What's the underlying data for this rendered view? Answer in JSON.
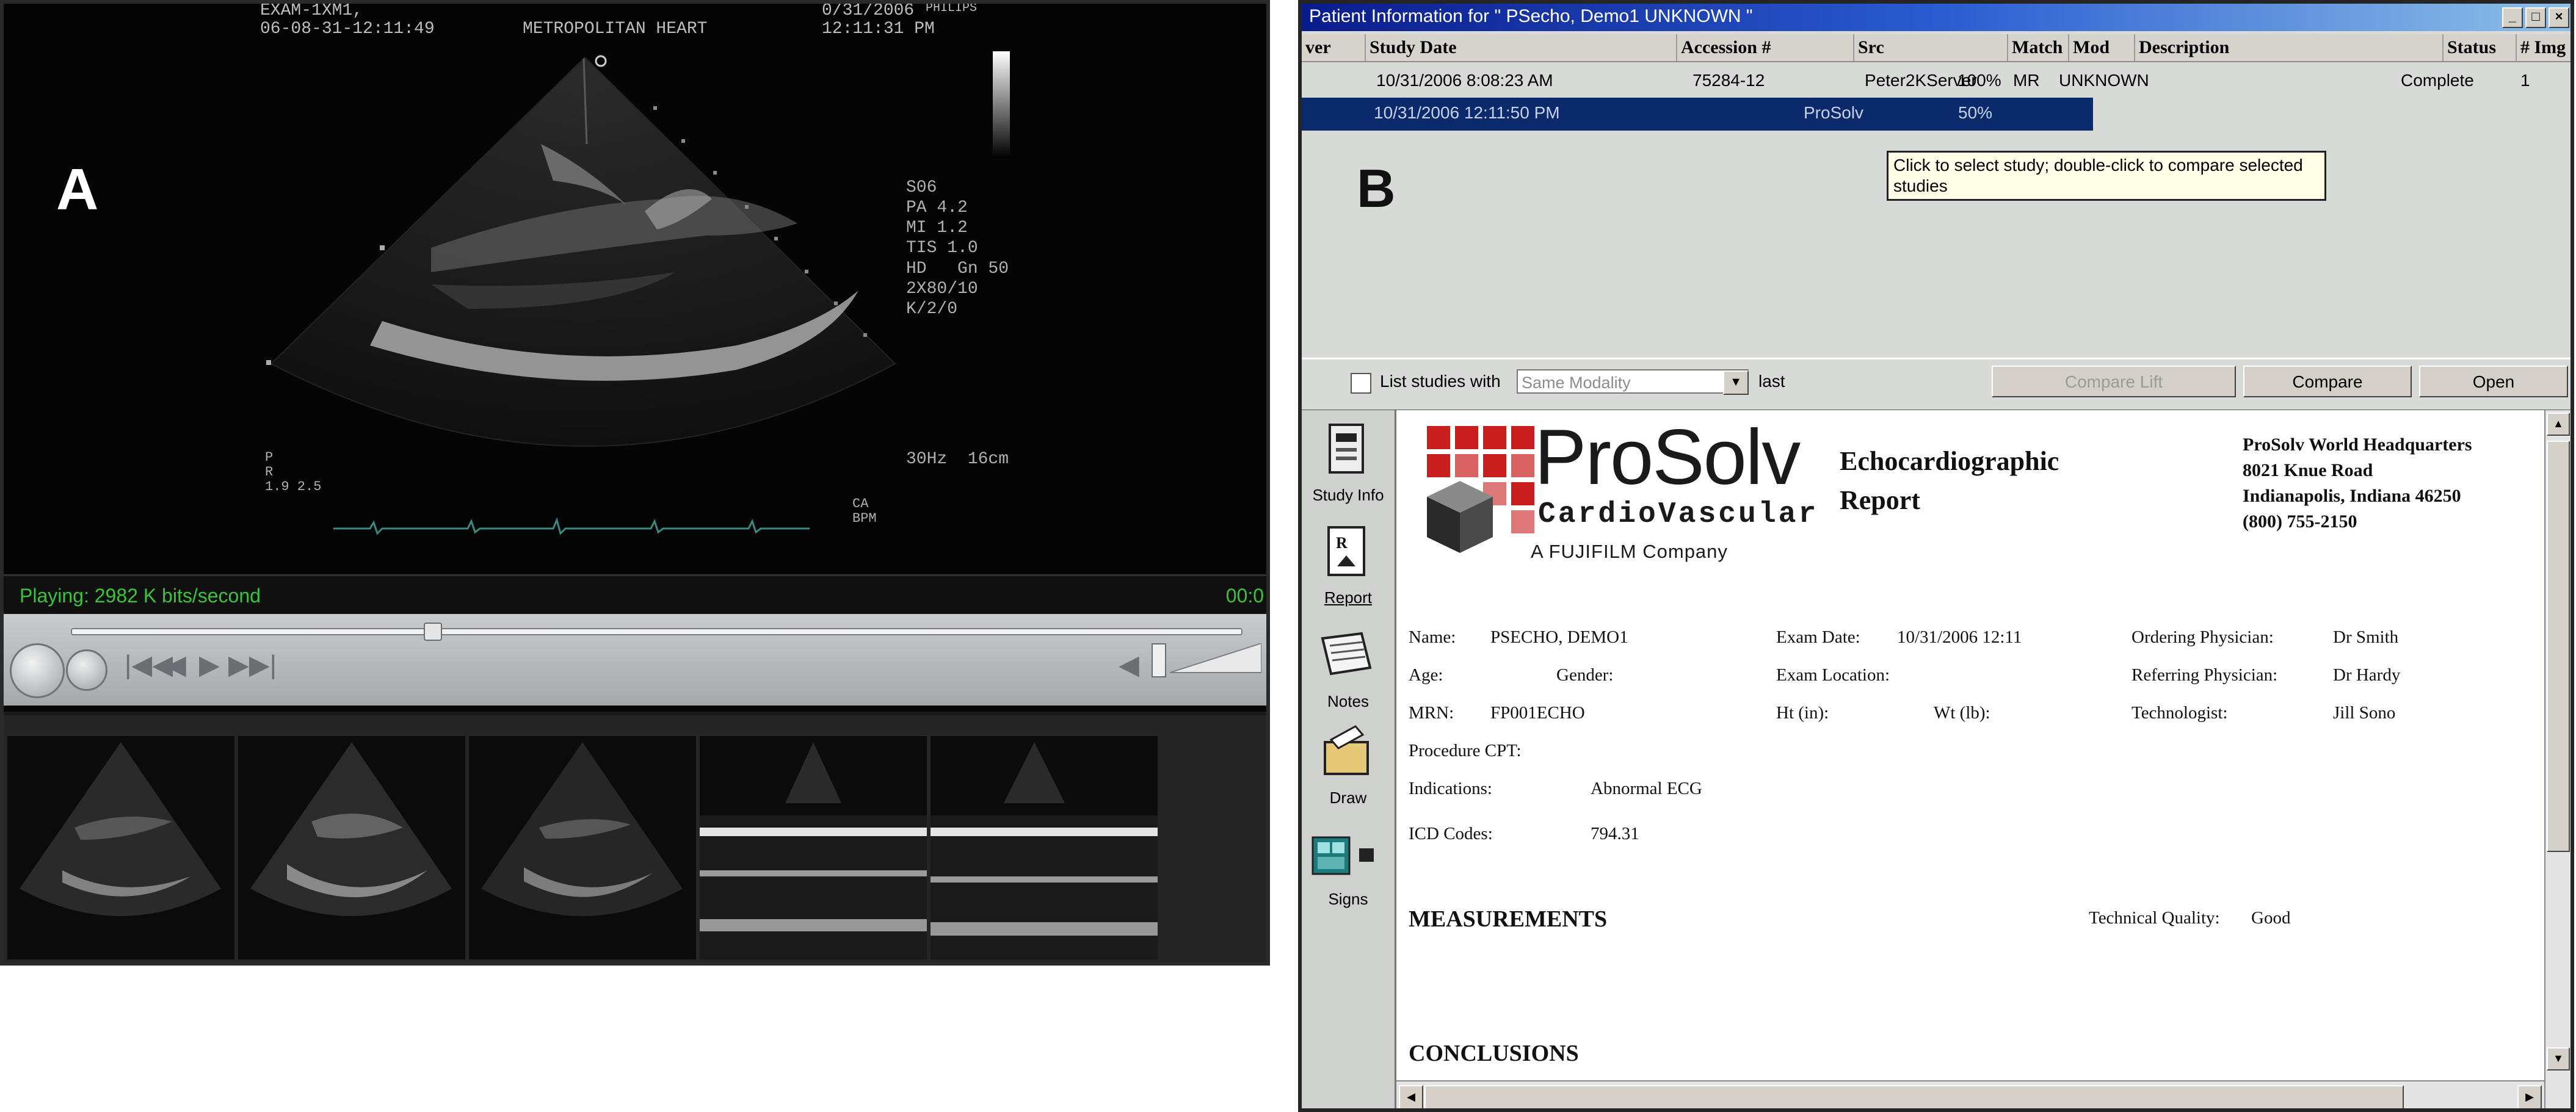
{
  "panel_a": {
    "label": "A",
    "header": {
      "line1_left": "EXAM-1XM1,",
      "line2_left": "06-08-31-12:11:49",
      "center": "METROPOLITAN HEART",
      "line1_right": "0/31/2006",
      "line1_brand": "PHILIPS",
      "line2_right": "12:11:31 PM"
    },
    "side_params": "S06\nPA 4.2\nMI 1.2\nTIS 1.0",
    "side_params2": "HD   Gn 50\n2X80/10\nK/2/0",
    "freq_depth": "30Hz  16cm",
    "lower_left": "P\nR\n1.9 2.5",
    "lower_right": "CA\nBPM",
    "status": {
      "playing": "Playing: 2982 K bits/second",
      "time": "00:0"
    },
    "controls": {
      "prev_icon": "|◀◀",
      "rewind_icon": "◀",
      "play_icon": "▶",
      "next_icon": "▶▶|",
      "speaker_icon": "◀"
    },
    "thumbnails": 5
  },
  "panel_b": {
    "label": "B",
    "window_title": "Patient Information for \" PSecho, Demo1      UNKNOWN \"",
    "window_buttons": [
      "_",
      "□",
      "×"
    ],
    "columns": [
      "ver",
      "Study Date",
      "Accession #",
      "Src",
      "Match",
      "Mod",
      "Description",
      "Status",
      "# Img"
    ],
    "rows": [
      {
        "ver": "",
        "date": "10/31/2006 8:08:23 AM",
        "accession": "75284-12",
        "src": "Peter2KServer",
        "match": "100%",
        "mod": "MR",
        "description": "UNKNOWN",
        "status": "Complete",
        "img": "1"
      },
      {
        "ver": "",
        "date": "10/31/2006 12:11:50 PM",
        "accession": "",
        "src": "ProSolv",
        "match": "50%",
        "mod": "",
        "description": "",
        "status": "",
        "img": ""
      }
    ],
    "tooltip": "Click to select study; double-click to compare selected studies",
    "filter": {
      "checkbox_label": "List studies with",
      "modality_placeholder": "Same Modality",
      "last_label": "last",
      "compare_lift": "Compare Lift",
      "compare": "Compare",
      "open": "Open"
    },
    "sidebar": [
      "Study Info",
      "Report",
      "Notes",
      "Draw",
      "Signs"
    ],
    "report": {
      "logo_name": "ProSolv",
      "logo_sub": "CardioVascular",
      "logo_company": "A FUJIFILM Company",
      "title_line1": "Echocardiographic",
      "title_line2": "Report",
      "hq_name": "ProSolv World Headquarters",
      "hq_address1": "8021 Knue Road",
      "hq_address2": "Indianapolis, Indiana 46250",
      "hq_phone": "(800) 755-2150",
      "name_label": "Name:",
      "name_value": "PSECHO, DEMO1",
      "exam_date_label": "Exam Date:",
      "exam_date_value": "10/31/2006 12:11",
      "ordering_label": "Ordering Physician:",
      "ordering_value": "Dr Smith",
      "age_label": "Age:",
      "gender_label": "Gender:",
      "exam_loc_label": "Exam Location:",
      "referring_label": "Referring Physician:",
      "referring_value": "Dr Hardy",
      "mrn_label": "MRN:",
      "mrn_value": "FP001ECHO",
      "ht_label": "Ht (in):",
      "wt_label": "Wt (lb):",
      "technologist_label": "Technologist:",
      "technologist_value": "Jill Sono",
      "cpt_label": "Procedure CPT:",
      "indications_label": "Indications:",
      "indications_value": "Abnormal ECG",
      "icd_label": "ICD Codes:",
      "icd_value": "794.31",
      "measurements": "MEASUREMENTS",
      "tech_quality_label": "Technical Quality:",
      "tech_quality_value": "Good",
      "conclusions": "CONCLUSIONS"
    }
  }
}
